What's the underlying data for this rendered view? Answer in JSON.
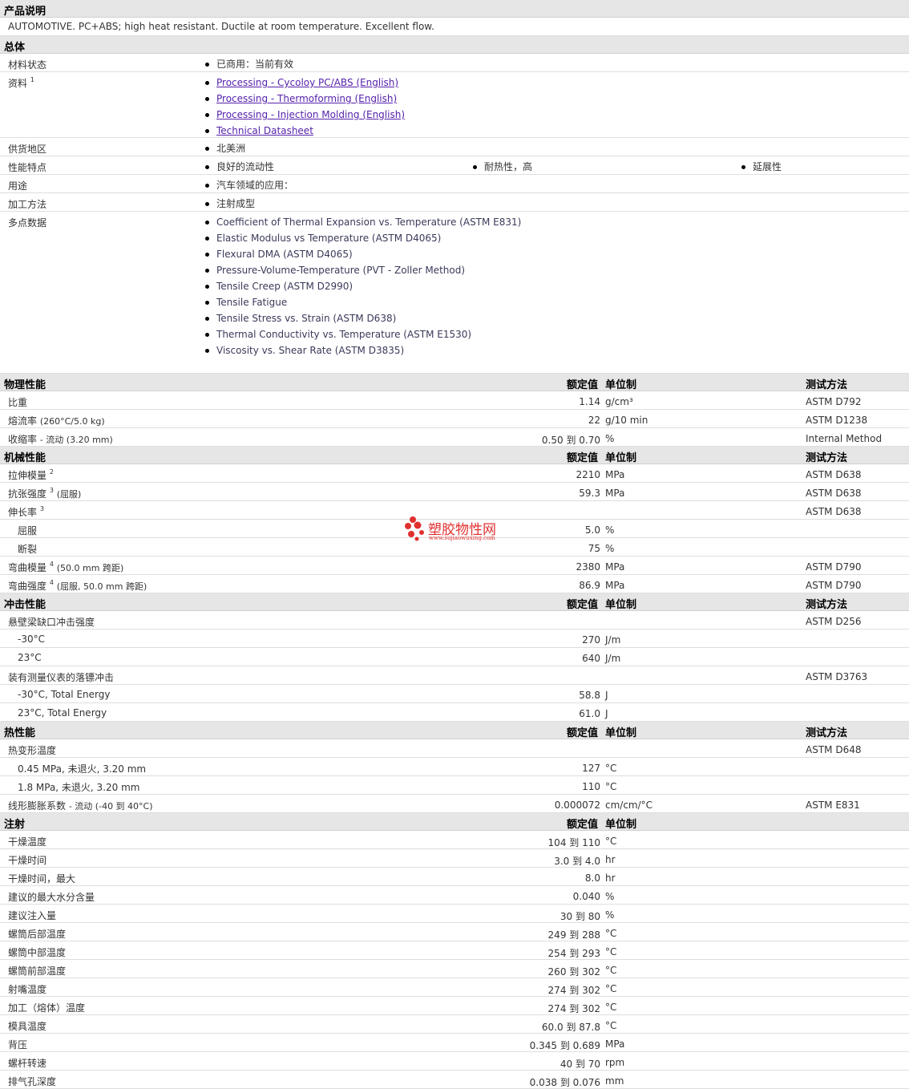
{
  "product_desc": {
    "title": "产品说明",
    "text": "AUTOMOTIVE. PC+ABS; high heat resistant. Ductile at room temperature. Excellent flow."
  },
  "general": {
    "title": "总体",
    "rows": [
      {
        "label": "材料状态",
        "items": [
          "已商用：当前有效"
        ]
      },
      {
        "label": "资料",
        "sup": "1",
        "links": [
          "Processing - Cycoloy PC/ABS (English)",
          "Processing - Thermoforming (English)",
          "Processing - Injection Molding (English)",
          "Technical Datasheet"
        ]
      },
      {
        "label": "供货地区",
        "items": [
          "北美洲"
        ]
      },
      {
        "label": "性能特点",
        "inline": [
          "良好的流动性",
          "耐热性，高",
          "延展性"
        ]
      },
      {
        "label": "用途",
        "items": [
          "汽车领域的应用："
        ]
      },
      {
        "label": "加工方法",
        "items": [
          "注射成型"
        ]
      },
      {
        "label": "多点数据",
        "data_items": [
          "Coefficient of Thermal Expansion vs. Temperature (ASTM E831)",
          "Elastic Modulus vs Temperature (ASTM D4065)",
          "Flexural DMA (ASTM D4065)",
          "Pressure-Volume-Temperature (PVT - Zoller Method)",
          "Tensile Creep (ASTM D2990)",
          "Tensile Fatigue",
          "Tensile Stress vs. Strain (ASTM D638)",
          "Thermal Conductivity vs. Temperature (ASTM E1530)",
          "Viscosity vs. Shear Rate (ASTM D3835)"
        ]
      }
    ]
  },
  "columns": {
    "value": "额定值",
    "unit": "单位制",
    "method": "测试方法"
  },
  "sections": [
    {
      "title": "物理性能",
      "method_col": true,
      "rows": [
        {
          "label": "比重",
          "value": "1.14",
          "unit": "g/cm³",
          "method": "ASTM D792"
        },
        {
          "label": "熔流率",
          "label_extra": "(260°C/5.0 kg)",
          "value": "22",
          "unit": "g/10 min",
          "method": "ASTM D1238"
        },
        {
          "label": "收缩率",
          "label_extra": "- 流动 (3.20 mm)",
          "value": "0.50 到  0.70",
          "unit": "%",
          "method": "Internal Method"
        }
      ]
    },
    {
      "title": "机械性能",
      "method_col": true,
      "rows": [
        {
          "label": "拉伸模量",
          "sup": "2",
          "value": "2210",
          "unit": "MPa",
          "method": "ASTM D638"
        },
        {
          "label": "抗张强度",
          "sup": "3",
          "label_extra": "(屈服)",
          "value": "59.3",
          "unit": "MPa",
          "method": "ASTM D638"
        },
        {
          "label": "伸长率",
          "sup": "3",
          "value": "",
          "unit": "",
          "method": "ASTM D638"
        },
        {
          "label": "屈服",
          "indent": true,
          "value": "5.0",
          "unit": "%",
          "method": ""
        },
        {
          "label": "断裂",
          "indent": true,
          "value": "75",
          "unit": "%",
          "method": ""
        },
        {
          "label": "弯曲模量",
          "sup": "4",
          "label_extra": "(50.0 mm 跨距)",
          "value": "2380",
          "unit": "MPa",
          "method": "ASTM D790"
        },
        {
          "label": "弯曲强度",
          "sup": "4",
          "label_extra": "(屈服, 50.0 mm 跨距)",
          "value": "86.9",
          "unit": "MPa",
          "method": "ASTM D790"
        }
      ]
    },
    {
      "title": "冲击性能",
      "method_col": true,
      "rows": [
        {
          "label": "悬壁梁缺口冲击强度",
          "value": "",
          "unit": "",
          "method": "ASTM D256"
        },
        {
          "label": "-30°C",
          "indent": true,
          "value": "270",
          "unit": "J/m",
          "method": ""
        },
        {
          "label": "23°C",
          "indent": true,
          "value": "640",
          "unit": "J/m",
          "method": ""
        },
        {
          "label": "装有测量仪表的落镖冲击",
          "value": "",
          "unit": "",
          "method": "ASTM D3763"
        },
        {
          "label": "-30°C, Total Energy",
          "indent": true,
          "value": "58.8",
          "unit": "J",
          "method": ""
        },
        {
          "label": "23°C, Total Energy",
          "indent": true,
          "value": "61.0",
          "unit": "J",
          "method": ""
        }
      ]
    },
    {
      "title": "热性能",
      "method_col": true,
      "rows": [
        {
          "label": "热变形温度",
          "value": "",
          "unit": "",
          "method": "ASTM D648"
        },
        {
          "label": "0.45 MPa, 未退火, 3.20 mm",
          "indent": true,
          "value": "127",
          "unit": "°C",
          "method": ""
        },
        {
          "label": "1.8 MPa, 未退火, 3.20 mm",
          "indent": true,
          "value": "110",
          "unit": "°C",
          "method": ""
        },
        {
          "label": "线形膨胀系数",
          "label_extra": "- 流动 (-40 到  40°C)",
          "value": "0.000072",
          "unit": "cm/cm/°C",
          "method": "ASTM E831"
        }
      ]
    },
    {
      "title": "注射",
      "method_col": false,
      "rows": [
        {
          "label": "干燥温度",
          "value": "104 到  110",
          "unit": "°C",
          "method": ""
        },
        {
          "label": "干燥时间",
          "value": "3.0 到  4.0",
          "unit": "hr",
          "method": ""
        },
        {
          "label": "干燥时间，最大",
          "value": "8.0",
          "unit": "hr",
          "method": ""
        },
        {
          "label": "建议的最大水分含量",
          "value": "0.040",
          "unit": "%",
          "method": ""
        },
        {
          "label": "建议注入量",
          "value": "30 到  80",
          "unit": "%",
          "method": ""
        },
        {
          "label": "螺筒后部温度",
          "value": "249 到  288",
          "unit": "°C",
          "method": ""
        },
        {
          "label": "螺筒中部温度",
          "value": "254 到  293",
          "unit": "°C",
          "method": ""
        },
        {
          "label": "螺筒前部温度",
          "value": "260 到  302",
          "unit": "°C",
          "method": ""
        },
        {
          "label": "射嘴温度",
          "value": "274 到  302",
          "unit": "°C",
          "method": ""
        },
        {
          "label": "加工（熔体）温度",
          "value": "274 到  302",
          "unit": "°C",
          "method": ""
        },
        {
          "label": "模具温度",
          "value": "60.0 到  87.8",
          "unit": "°C",
          "method": ""
        },
        {
          "label": "背压",
          "value": "0.345 到  0.689",
          "unit": "MPa",
          "method": ""
        },
        {
          "label": "螺杆转速",
          "value": "40 到  70",
          "unit": "rpm",
          "method": ""
        },
        {
          "label": "排气孔深度",
          "value": "0.038 到  0.076",
          "unit": "mm",
          "method": ""
        }
      ]
    }
  ],
  "watermark": {
    "text": "塑胶物性网",
    "url": "www.sujiaowuxing.com",
    "color": "#e03030"
  }
}
